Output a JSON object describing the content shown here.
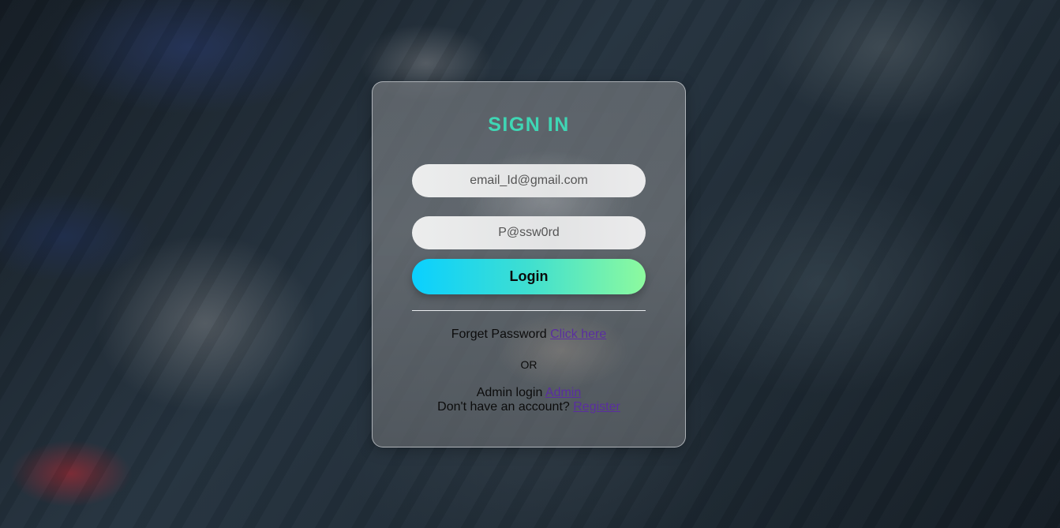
{
  "login_form": {
    "title": "SIGN IN",
    "email_placeholder": "email_Id@gmail.com",
    "password_placeholder": "P@ssw0rd",
    "login_button": "Login",
    "forgot_password_text": "Forget Password",
    "forgot_password_link": "Click here",
    "or_text": "OR",
    "admin_login_text": "Admin login",
    "admin_link": "Admin",
    "no_account_text": "Don't have an account?",
    "register_link": "Register"
  },
  "colors": {
    "title": "#3fd6b4",
    "button_gradient_start": "#0ad0ff",
    "button_gradient_end": "#8dfa9e",
    "link": "#5a2ea0"
  }
}
